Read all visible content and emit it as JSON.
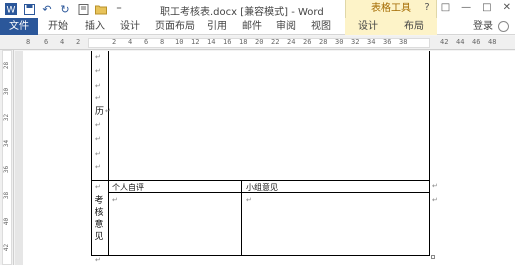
{
  "window": {
    "doc_title": "职工考核表.docx [兼容模式] - Word",
    "context_group": "表格工具",
    "controls": {
      "help": "?",
      "restore": "□",
      "minimize": "—",
      "maximize": "□",
      "close": "✕"
    }
  },
  "quick_access": {
    "icons": [
      "word-logo-icon",
      "save-icon",
      "undo-icon",
      "redo-icon",
      "print-preview-icon",
      "open-folder-icon",
      "more-icon"
    ]
  },
  "ribbon": {
    "tabs": [
      "文件",
      "开始",
      "插入",
      "设计",
      "页面布局",
      "引用",
      "邮件",
      "审阅",
      "视图"
    ],
    "context_tabs": [
      "设计",
      "布局"
    ],
    "login": "登录"
  },
  "ruler": {
    "h_numbers": [
      "8",
      "6",
      "4",
      "2",
      "2",
      "4",
      "6",
      "8",
      "10",
      "12",
      "14",
      "16",
      "18",
      "20",
      "22",
      "24",
      "26",
      "28",
      "30",
      "32",
      "34",
      "36",
      "38",
      "42",
      "44",
      "46",
      "48"
    ],
    "v_numbers": [
      "28",
      "30",
      "32",
      "34",
      "36",
      "38",
      "40",
      "42"
    ]
  },
  "table": {
    "row_label_top": "历",
    "row_label_bottom": "考核意见",
    "col_self": "个人自评",
    "col_group": "小组意见",
    "para_mark": "↵"
  }
}
